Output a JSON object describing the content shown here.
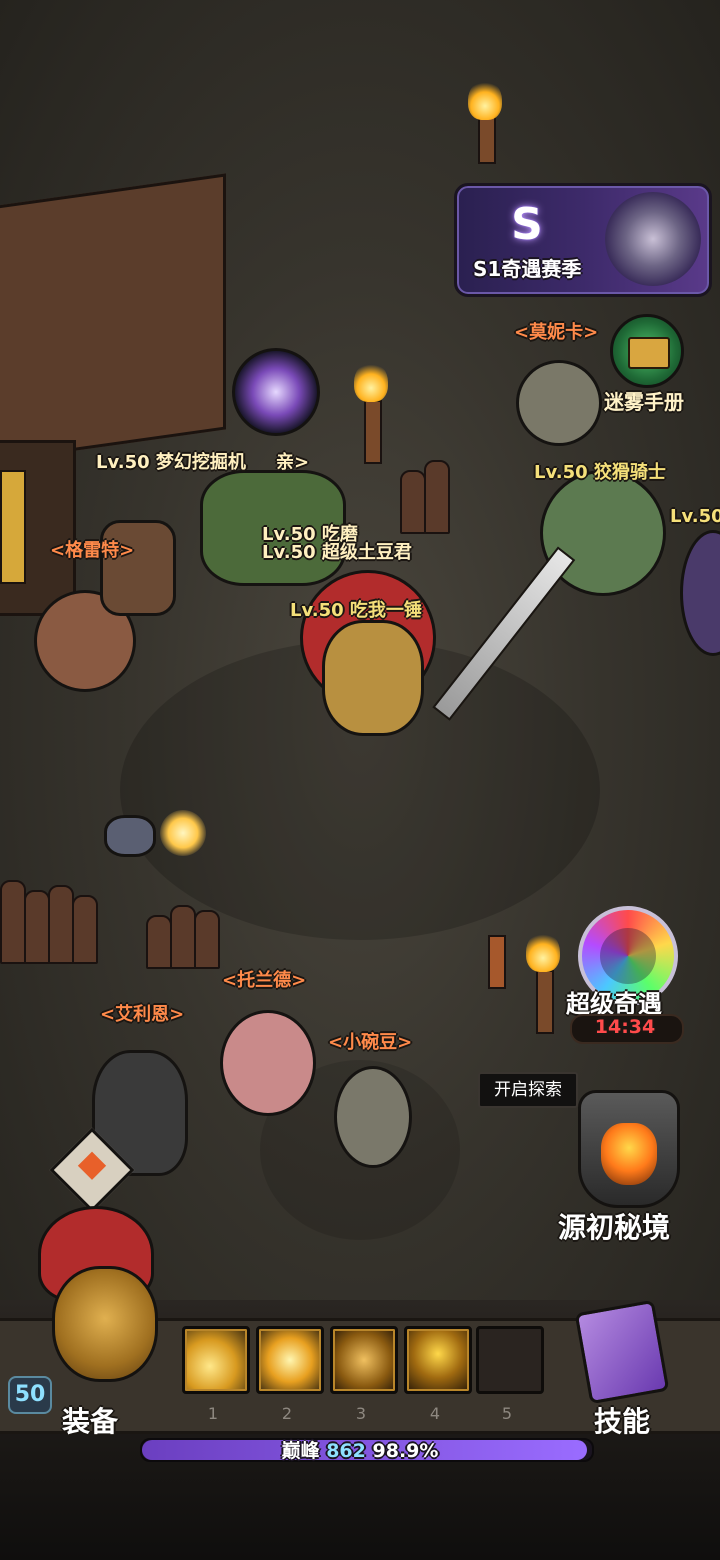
{
  "season_banner": {
    "logo": "S",
    "label": "S1奇遇赛季"
  },
  "fog_manual": {
    "label": "迷雾手册",
    "icon": "book-icon"
  },
  "super_encounter": {
    "label": "超级奇遇",
    "timer": "14:34"
  },
  "explore_tooltip": "开启探索",
  "origin_realm": {
    "label": "源初秘境"
  },
  "npc_labels": {
    "monica": "<莫妮卡>",
    "gret": "<格雷特>",
    "toland": "<托兰德>",
    "ailien": "<艾利恩>",
    "xiaowandou": "<小碗豆>"
  },
  "player_labels": {
    "dream_miner": "Lv.50 梦幻挖掘机",
    "dream_miner_suffix": "亲>",
    "cunning_knight": "Lv.50 狡猾骑士",
    "lv50_edge": "Lv.50",
    "chimo": "Lv.50 吃磨",
    "super_potato": "Lv.50 超级土豆君",
    "self": "Lv.50 吃我一锤"
  },
  "hud": {
    "level": "50",
    "equip_label": "装备",
    "skill_label": "技能",
    "skill_slots": [
      {
        "num": "1",
        "icon": "golden-slash-icon",
        "empty": false
      },
      {
        "num": "2",
        "icon": "lightning-burst-icon",
        "empty": false
      },
      {
        "num": "3",
        "icon": "whirlwind-icon",
        "empty": false
      },
      {
        "num": "4",
        "icon": "demon-helm-icon",
        "empty": false
      },
      {
        "num": "5",
        "icon": "",
        "empty": true
      }
    ],
    "xp_prefix": "巅峰",
    "xp_level": "862",
    "xp_percent_text": "98.9%",
    "xp_percent": 98.9
  },
  "colors": {
    "accent_purple": "#9a6cff",
    "name_orange": "#ff8a4a",
    "name_yellow": "#f5e07a",
    "timer_red": "#ff4b4b"
  }
}
